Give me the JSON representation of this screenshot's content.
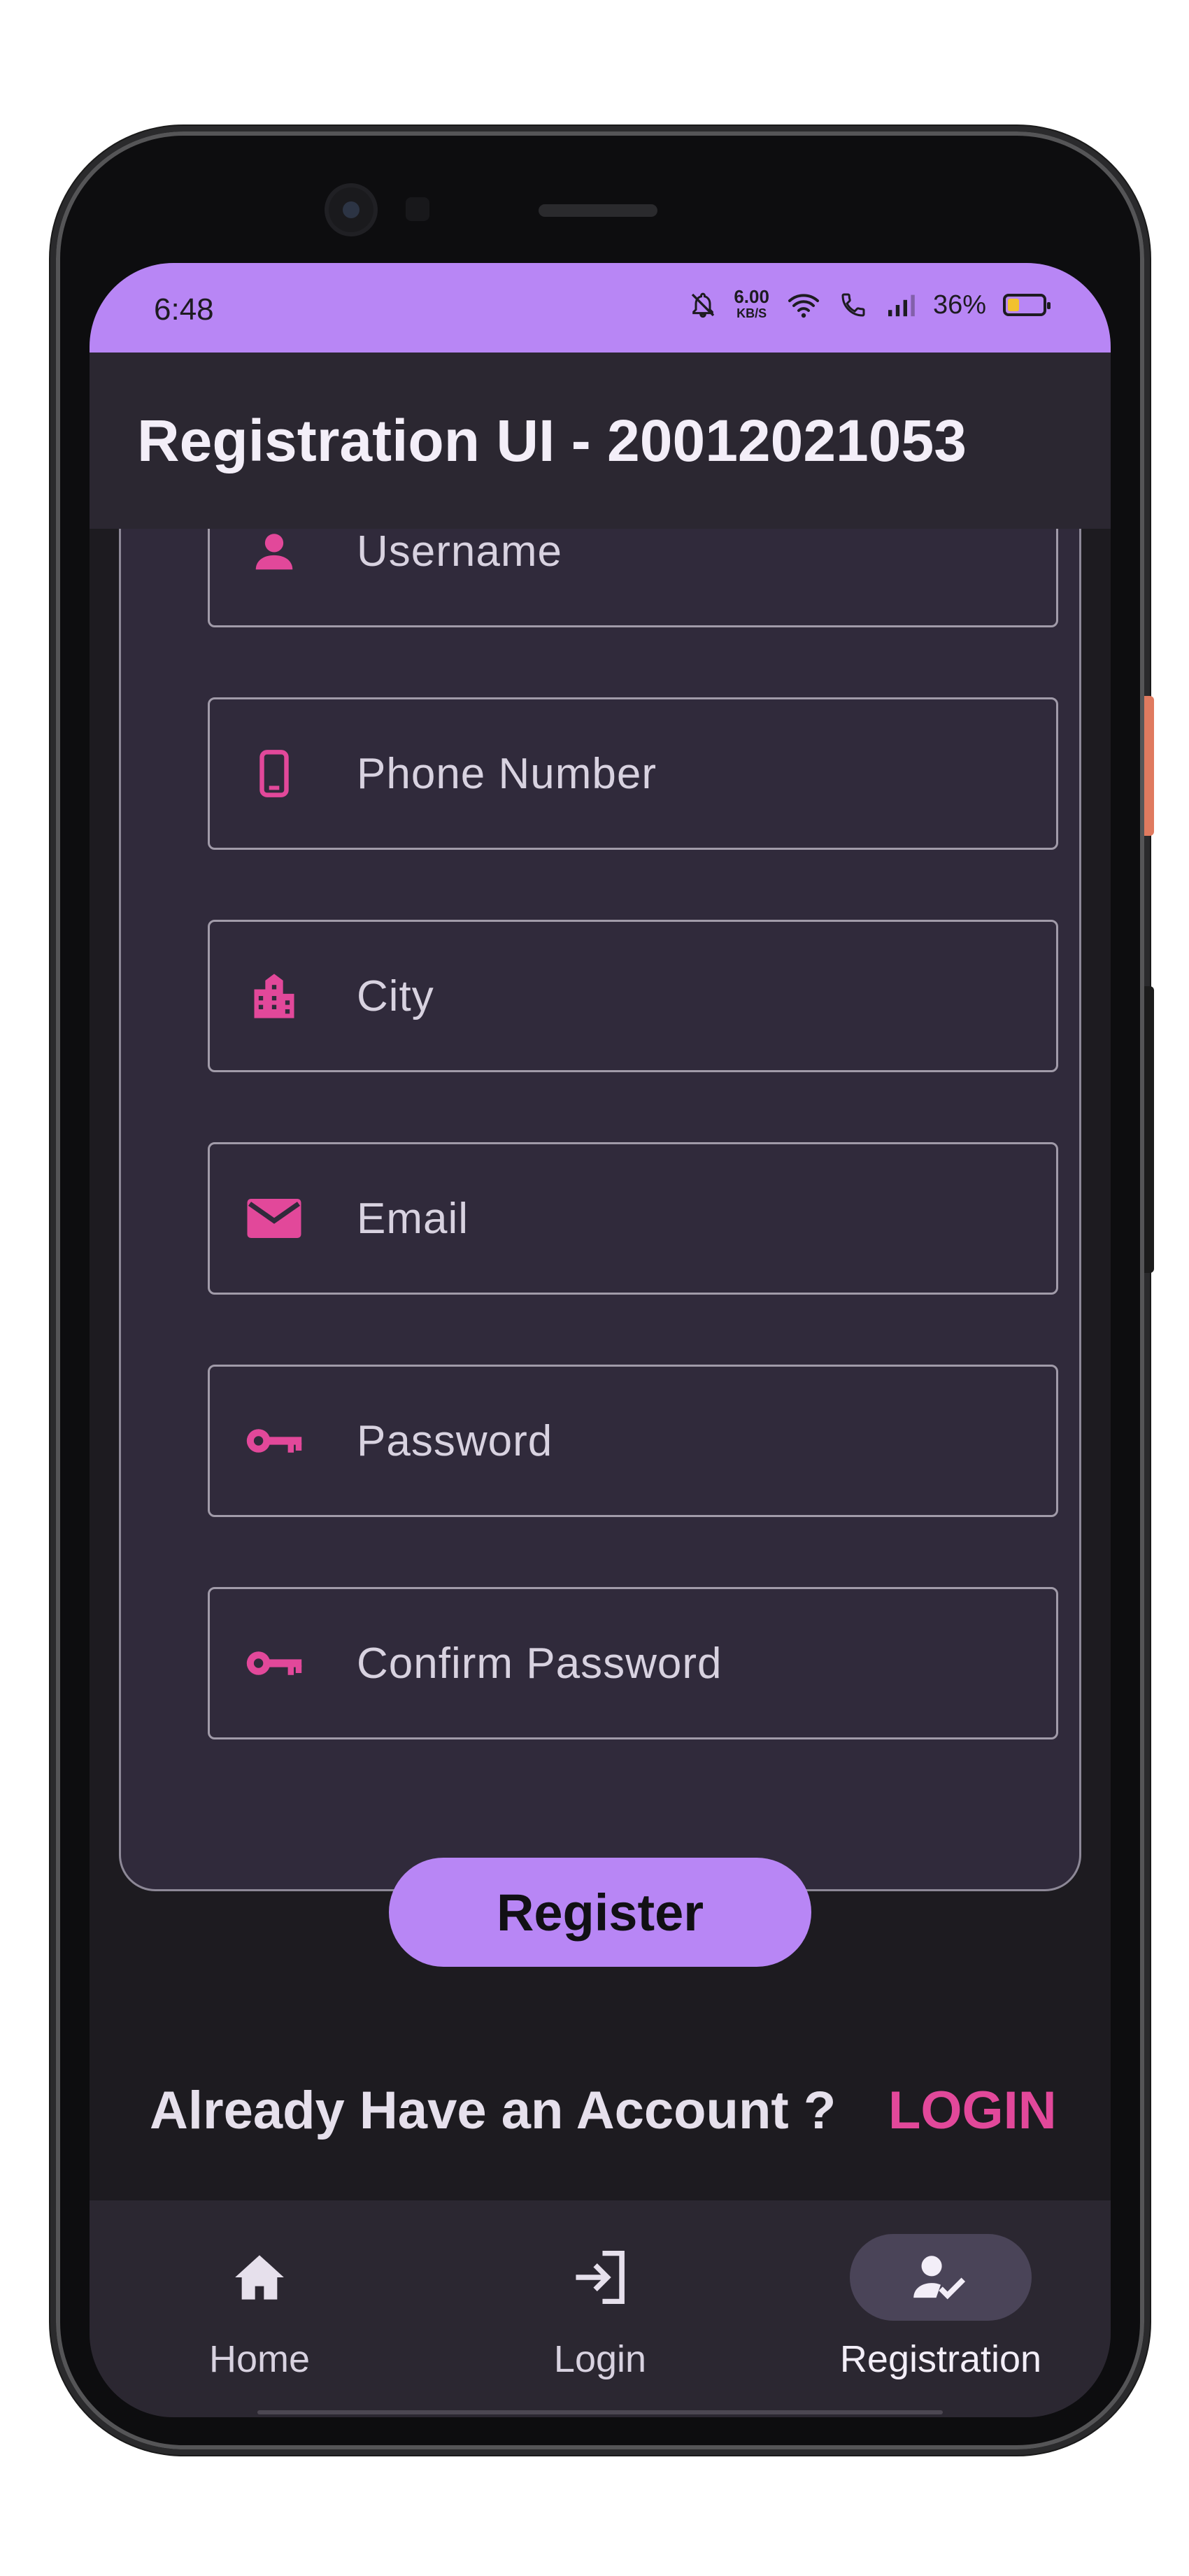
{
  "status": {
    "time": "6:48",
    "net_speed_value": "6.00",
    "net_speed_unit": "KB/S",
    "battery_percent": "36%",
    "battery_level": 0.36
  },
  "app": {
    "title": "Registration UI - 20012021053"
  },
  "form": {
    "fields": [
      {
        "placeholder": "Username",
        "icon": "person-icon"
      },
      {
        "placeholder": "Phone Number",
        "icon": "phone-icon"
      },
      {
        "placeholder": "City",
        "icon": "city-icon"
      },
      {
        "placeholder": "Email",
        "icon": "email-icon"
      },
      {
        "placeholder": "Password",
        "icon": "key-icon"
      },
      {
        "placeholder": "Confirm Password",
        "icon": "key-icon"
      }
    ],
    "register_label": "Register"
  },
  "footer": {
    "prompt": "Already Have an Account ?",
    "login_link": "LOGIN"
  },
  "nav": {
    "items": [
      {
        "label": "Home",
        "icon": "home-icon"
      },
      {
        "label": "Login",
        "icon": "login-icon"
      },
      {
        "label": "Registration",
        "icon": "person-check-icon",
        "active": true
      }
    ]
  },
  "colors": {
    "accent": "#b886f5",
    "icon_pink": "#e2489a",
    "card": "#302a3b",
    "appbar": "#2b2731"
  }
}
